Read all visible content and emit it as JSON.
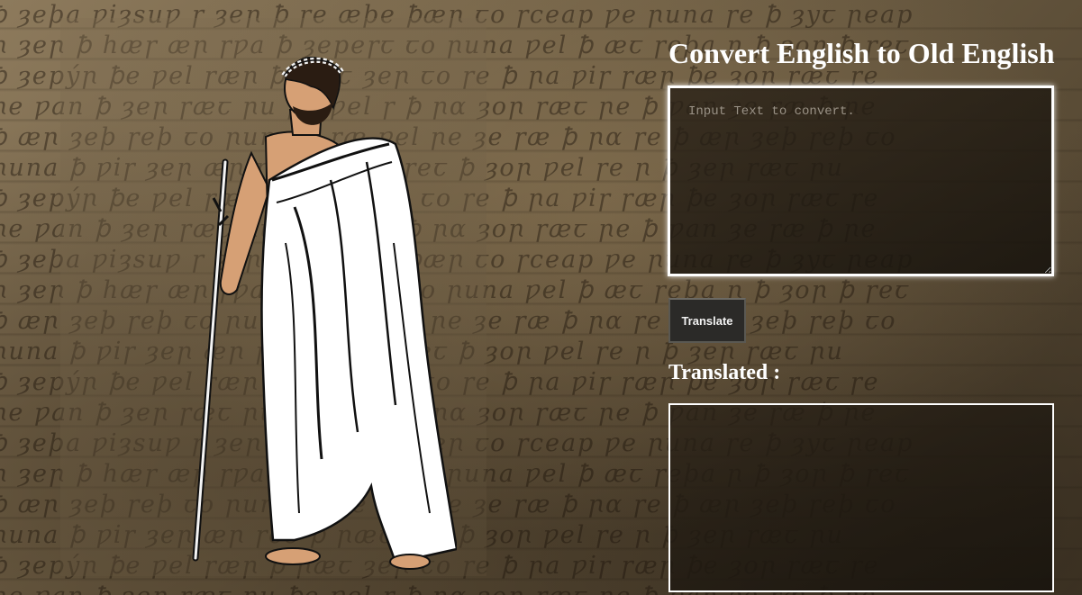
{
  "converter": {
    "title": "Convert English to Old English",
    "input": {
      "placeholder": "Input Text to convert.",
      "value": ""
    },
    "translate_button_label": "Translate",
    "output_heading": "Translated :",
    "output_text": ""
  },
  "illustration": {
    "subject": "figure in white toga with laurel wreath holding a staff",
    "icon": "toga-figure-icon"
  },
  "colors": {
    "heading_text": "#ffffff",
    "textarea_border": "#ffffff",
    "button_bg": "#2b2a28",
    "toga": "#ffffff",
    "skin": "#d6a075",
    "parchment": "#7a6a4f"
  }
}
